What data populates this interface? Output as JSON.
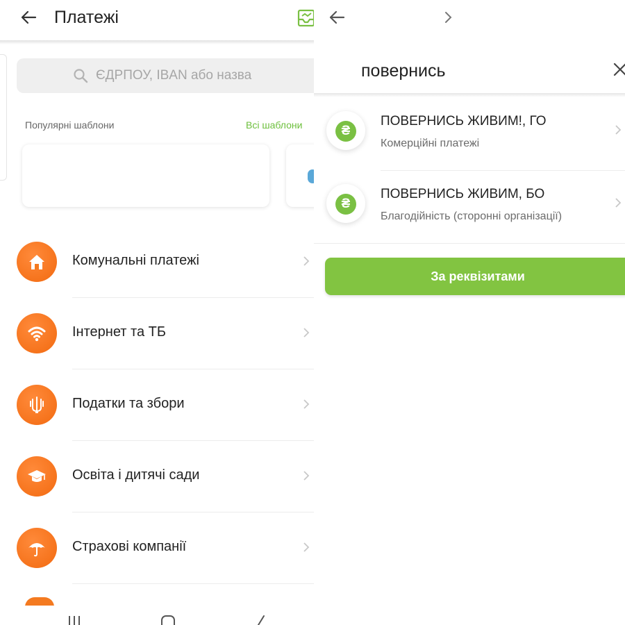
{
  "left": {
    "header": {
      "title": "Платежі",
      "back_icon": "back-arrow-icon",
      "tray_icon": "inbox-icon"
    },
    "search": {
      "placeholder": "ЄДРПОУ, IBAN або назва"
    },
    "templates": {
      "label": "Популярні шаблони",
      "all_link": "Всі шаблони"
    },
    "categories": [
      {
        "label": "Комунальні платежі",
        "icon": "house-icon"
      },
      {
        "label": "Інтернет та ТБ",
        "icon": "wifi-icon"
      },
      {
        "label": "Податки та збори",
        "icon": "trident-icon"
      },
      {
        "label": "Освіта і дитячі сади",
        "icon": "graduation-cap-icon"
      },
      {
        "label": "Страхові компанії",
        "icon": "umbrella-icon"
      }
    ]
  },
  "right": {
    "search_query": "повернись",
    "results": [
      {
        "title": "ПОВЕРНИСЬ ЖИВИМ!, ГО",
        "subtitle": "Комерційні платежі",
        "icon": "hryvnia-icon",
        "coin": "₴"
      },
      {
        "title": "ПОВЕРНИСЬ ЖИВИМ, БО",
        "subtitle": "Благодійність (сторонні організації)",
        "icon": "hryvnia-icon",
        "coin": "₴"
      }
    ],
    "requisites_button": "За реквізитами"
  },
  "colors": {
    "accent_green": "#82c441",
    "accent_orange": "#f26a10",
    "link_green": "#6cbf3b"
  }
}
